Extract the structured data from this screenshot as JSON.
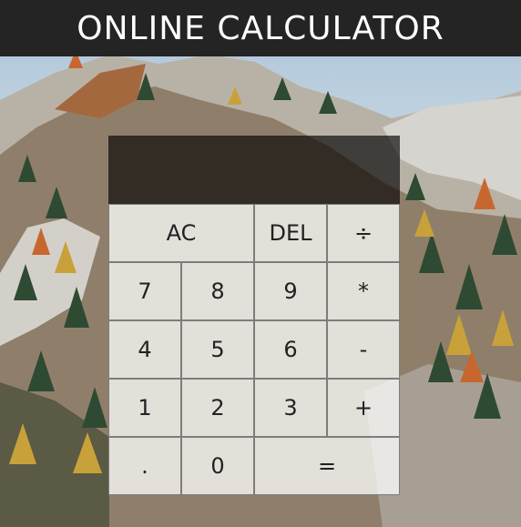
{
  "header": {
    "title": "ONLINE CALCULATOR"
  },
  "display": {
    "previous_operand": "",
    "current_operand": ""
  },
  "buttons": {
    "ac": "AC",
    "del": "DEL",
    "divide": "÷",
    "seven": "7",
    "eight": "8",
    "nine": "9",
    "multiply": "*",
    "four": "4",
    "five": "5",
    "six": "6",
    "subtract": "-",
    "one": "1",
    "two": "2",
    "three": "3",
    "add": "+",
    "decimal": ".",
    "zero": "0",
    "equals": "="
  },
  "colors": {
    "header_bg": "#242424",
    "display_bg": "rgba(0,0,0,0.65)",
    "button_bg": "rgba(255,255,255,0.75)",
    "button_border": "#7d7d7d"
  }
}
